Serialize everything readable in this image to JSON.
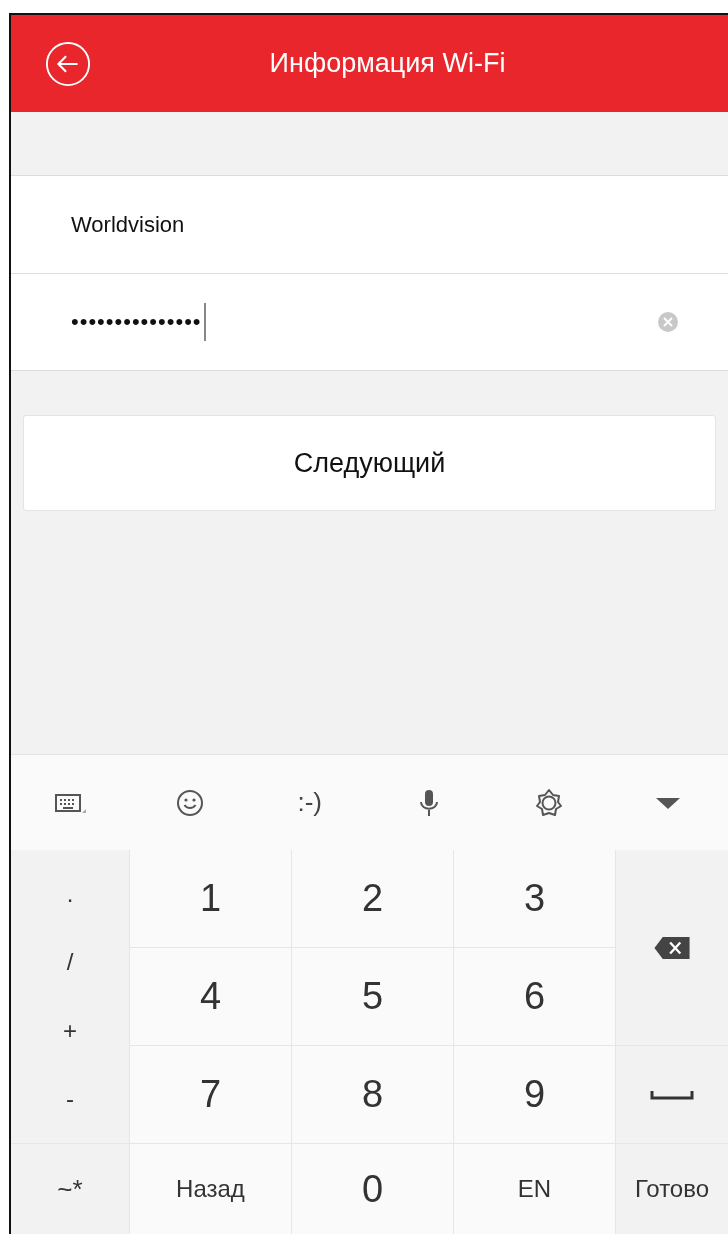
{
  "header": {
    "title": "Информация Wi-Fi"
  },
  "form": {
    "ssid": "Worldvision",
    "password": "•••••••••••••••",
    "password_focused": true
  },
  "next_button": "Следующий",
  "keyboard_toolbar": [
    {
      "kind": "keyboard"
    },
    {
      "kind": "emoji"
    },
    {
      "kind": "text",
      "label": ":-)"
    },
    {
      "kind": "mic"
    },
    {
      "kind": "settings"
    },
    {
      "kind": "collapse"
    }
  ],
  "keyboard": {
    "symbols": [
      ".",
      "/",
      "+",
      "-"
    ],
    "symbol_key": "~*",
    "keys": [
      {
        "label": "1"
      },
      {
        "label": "2"
      },
      {
        "label": "3"
      },
      {
        "label": "4"
      },
      {
        "label": "5"
      },
      {
        "label": "6"
      },
      {
        "label": "7"
      },
      {
        "label": "8"
      },
      {
        "label": "9"
      },
      {
        "label": "Назад",
        "kind": "word"
      },
      {
        "label": "0"
      },
      {
        "label": "EN",
        "kind": "word"
      }
    ],
    "done_key": "Готово"
  }
}
